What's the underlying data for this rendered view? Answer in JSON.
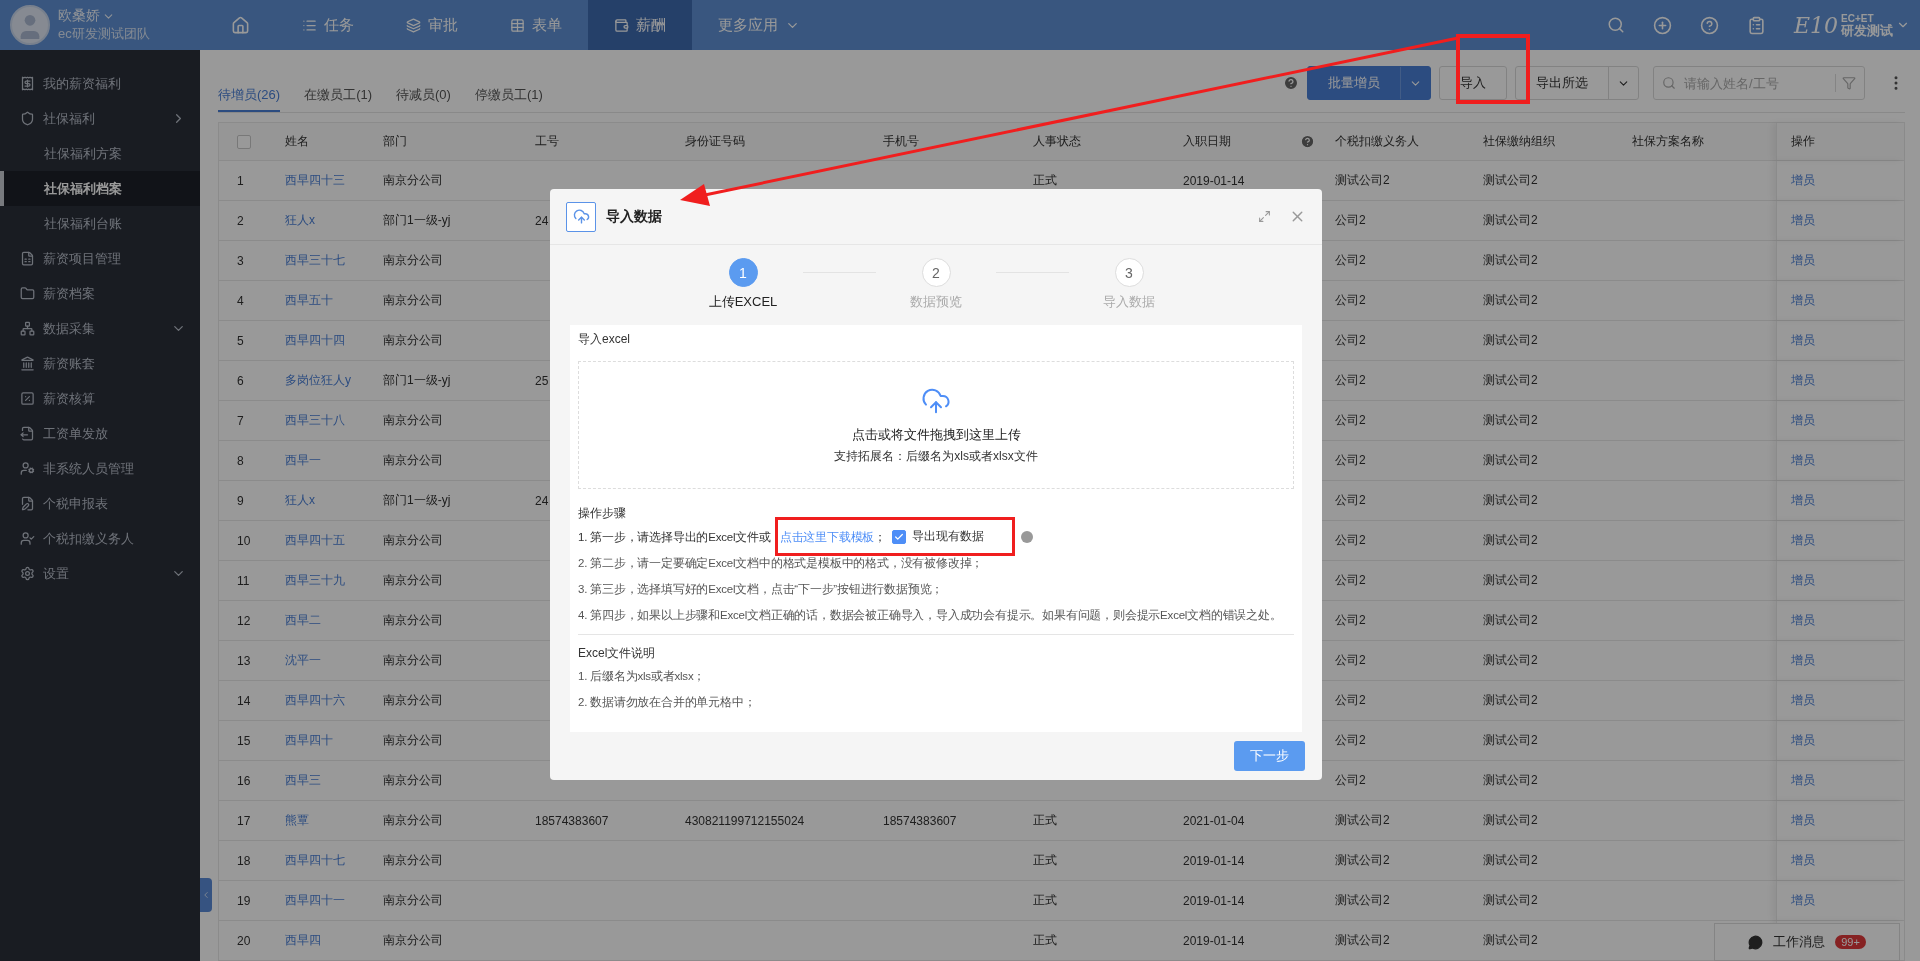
{
  "topbar": {
    "user": {
      "name": "欧桑娇",
      "team": "ec研发测试团队"
    },
    "nav": [
      {
        "kind": "home",
        "selected": false
      },
      {
        "kind": "link",
        "label": "任务",
        "selected": false
      },
      {
        "kind": "link",
        "label": "审批",
        "selected": false
      },
      {
        "kind": "link",
        "label": "表单",
        "selected": false
      },
      {
        "kind": "link",
        "label": "薪酬",
        "selected": true
      },
      {
        "kind": "menu",
        "label": "更多应用",
        "selected": false
      }
    ],
    "logo": {
      "brand": "E10",
      "tag": "EC+ET",
      "name": "研发测试"
    }
  },
  "sidebar": {
    "items": [
      {
        "kind": "item",
        "label": "我的薪资福利",
        "selected": false
      },
      {
        "kind": "group",
        "label": "社保福利",
        "selected": false,
        "expanded": true,
        "children": [
          {
            "kind": "item",
            "label": "社保福利方案",
            "selected": false
          },
          {
            "kind": "item",
            "label": "社保福利档案",
            "selected": true
          },
          {
            "kind": "item",
            "label": "社保福利台账",
            "selected": false
          }
        ]
      },
      {
        "kind": "item",
        "label": "薪资项目管理",
        "selected": false
      },
      {
        "kind": "item",
        "label": "薪资档案",
        "selected": false
      },
      {
        "kind": "group",
        "label": "数据采集",
        "selected": false,
        "expanded": false
      },
      {
        "kind": "item",
        "label": "薪资账套",
        "selected": false
      },
      {
        "kind": "item",
        "label": "薪资核算",
        "selected": false
      },
      {
        "kind": "item",
        "label": "工资单发放",
        "selected": false
      },
      {
        "kind": "item",
        "label": "非系统人员管理",
        "selected": false
      },
      {
        "kind": "item",
        "label": "个税申报表",
        "selected": false
      },
      {
        "kind": "item",
        "label": "个税扣缴义务人",
        "selected": false
      },
      {
        "kind": "group",
        "label": "设置",
        "selected": false,
        "expanded": false
      }
    ]
  },
  "tabs": [
    {
      "label": "待增员(26)",
      "selected": true
    },
    {
      "label": "在缴员工(1)",
      "selected": false
    },
    {
      "label": "待减员(0)",
      "selected": false
    },
    {
      "label": "停缴员工(1)",
      "selected": false
    }
  ],
  "toolbar": {
    "buttons": [
      {
        "kind": "primary-split",
        "label": "批量增员"
      },
      {
        "kind": "plain",
        "label": "导入"
      },
      {
        "kind": "split",
        "label": "导出所选"
      }
    ],
    "search": {
      "placeholder": "请输入姓名/工号"
    }
  },
  "table": {
    "select_all": {
      "checked": false
    },
    "columns": [
      {
        "label": "姓名",
        "help": false
      },
      {
        "label": "部门",
        "help": false
      },
      {
        "label": "工号",
        "help": false
      },
      {
        "label": "身份证号码",
        "help": false
      },
      {
        "label": "手机号",
        "help": false
      },
      {
        "label": "人事状态",
        "help": false
      },
      {
        "label": "入职日期",
        "help": true
      },
      {
        "label": "个税扣缴义务人",
        "help": false
      },
      {
        "label": "社保缴纳组织",
        "help": false
      },
      {
        "label": "社保方案名称",
        "help": false
      },
      {
        "label": "操作",
        "help": false
      }
    ],
    "rows": [
      {
        "no": "1",
        "name": "西早四十三",
        "dept": "南京分公司",
        "status": "正式",
        "join_date": "2019-01-14",
        "tax_payer": "测试公司2",
        "org": "测试公司2",
        "action": "增员"
      },
      {
        "no": "2",
        "name": "狂人x",
        "dept": "部门1一级-yj",
        "emp_id": "24",
        "tax_payer": "公司2",
        "org": "测试公司2",
        "action": "增员"
      },
      {
        "no": "3",
        "name": "西早三十七",
        "dept": "南京分公司",
        "tax_payer": "公司2",
        "org": "测试公司2",
        "action": "增员"
      },
      {
        "no": "4",
        "name": "西早五十",
        "dept": "南京分公司",
        "tax_payer": "公司2",
        "org": "测试公司2",
        "action": "增员"
      },
      {
        "no": "5",
        "name": "西早四十四",
        "dept": "南京分公司",
        "tax_payer": "公司2",
        "org": "测试公司2",
        "action": "增员"
      },
      {
        "no": "6",
        "name": "多岗位狂人y",
        "dept": "部门1一级-yj",
        "emp_id": "25",
        "tax_payer": "公司2",
        "org": "测试公司2",
        "action": "增员"
      },
      {
        "no": "7",
        "name": "西早三十八",
        "dept": "南京分公司",
        "tax_payer": "公司2",
        "org": "测试公司2",
        "action": "增员"
      },
      {
        "no": "8",
        "name": "西早一",
        "dept": "南京分公司",
        "tax_payer": "公司2",
        "org": "测试公司2",
        "action": "增员"
      },
      {
        "no": "9",
        "name": "狂人x",
        "dept": "部门1一级-yj",
        "emp_id": "24",
        "tax_payer": "公司2",
        "org": "测试公司2",
        "action": "增员"
      },
      {
        "no": "10",
        "name": "西早四十五",
        "dept": "南京分公司",
        "tax_payer": "公司2",
        "org": "测试公司2",
        "action": "增员"
      },
      {
        "no": "11",
        "name": "西早三十九",
        "dept": "南京分公司",
        "tax_payer": "公司2",
        "org": "测试公司2",
        "action": "增员"
      },
      {
        "no": "12",
        "name": "西早二",
        "dept": "南京分公司",
        "tax_payer": "公司2",
        "org": "测试公司2",
        "action": "增员"
      },
      {
        "no": "13",
        "name": "沈平一",
        "dept": "南京分公司",
        "tax_payer": "公司2",
        "org": "测试公司2",
        "action": "增员"
      },
      {
        "no": "14",
        "name": "西早四十六",
        "dept": "南京分公司",
        "tax_payer": "公司2",
        "org": "测试公司2",
        "action": "增员"
      },
      {
        "no": "15",
        "name": "西早四十",
        "dept": "南京分公司",
        "tax_payer": "公司2",
        "org": "测试公司2",
        "action": "增员"
      },
      {
        "no": "16",
        "name": "西早三",
        "dept": "南京分公司",
        "tax_payer": "公司2",
        "org": "测试公司2",
        "action": "增员"
      },
      {
        "no": "17",
        "name": "熊覃",
        "dept": "南京分公司",
        "emp_id": "18574383607",
        "id_card": "430821199712155024",
        "phone": "18574383607",
        "status": "正式",
        "join_date": "2021-01-04",
        "tax_payer": "测试公司2",
        "org": "测试公司2",
        "action": "增员"
      },
      {
        "no": "18",
        "name": "西早四十七",
        "dept": "南京分公司",
        "status": "正式",
        "join_date": "2019-01-14",
        "tax_payer": "测试公司2",
        "org": "测试公司2",
        "action": "增员"
      },
      {
        "no": "19",
        "name": "西早四十一",
        "dept": "南京分公司",
        "status": "正式",
        "join_date": "2019-01-14",
        "tax_payer": "测试公司2",
        "org": "测试公司2",
        "action": "增员"
      },
      {
        "no": "20",
        "name": "西早四",
        "dept": "南京分公司",
        "status": "正式",
        "join_date": "2019-01-14",
        "tax_payer": "测试公司2",
        "org": "测试公司2"
      }
    ]
  },
  "dialog": {
    "title": "导入数据",
    "steps": [
      {
        "number": "1",
        "label": "上传EXCEL",
        "selected": true
      },
      {
        "number": "2",
        "label": "数据预览",
        "selected": false
      },
      {
        "number": "3",
        "label": "导入数据",
        "selected": false
      }
    ],
    "section_title": "导入excel",
    "dropzone": {
      "text": "点击或将文件拖拽到这里上传",
      "hint": "支持拓展名：后缀名为xls或者xlsx文件"
    },
    "instructions_title": "操作步骤",
    "first_step": {
      "text": "1. 第一步，请选择导出的Excel文件或",
      "link": "点击这里下载模板",
      "tail": "；",
      "checkbox": {
        "label": "导出现有数据",
        "checked": true
      }
    },
    "other_steps": [
      "2. 第二步，请一定要确定Excel文档中的格式是模板中的格式，没有被修改掉；",
      "3. 第三步，选择填写好的Excel文档，点击“下一步”按钮进行数据预览；",
      "4. 第四步，如果以上步骤和Excel文档正确的话，数据会被正确导入，导入成功会有提示。如果有问题，则会提示Excel文档的错误之处。"
    ],
    "notes_title": "Excel文件说明",
    "notes": [
      "1. 后缀名为xls或者xlsx；",
      "2. 数据请勿放在合并的单元格中；"
    ],
    "next_button": "下一步"
  },
  "messages": {
    "label": "工作消息",
    "badge": "99+"
  }
}
